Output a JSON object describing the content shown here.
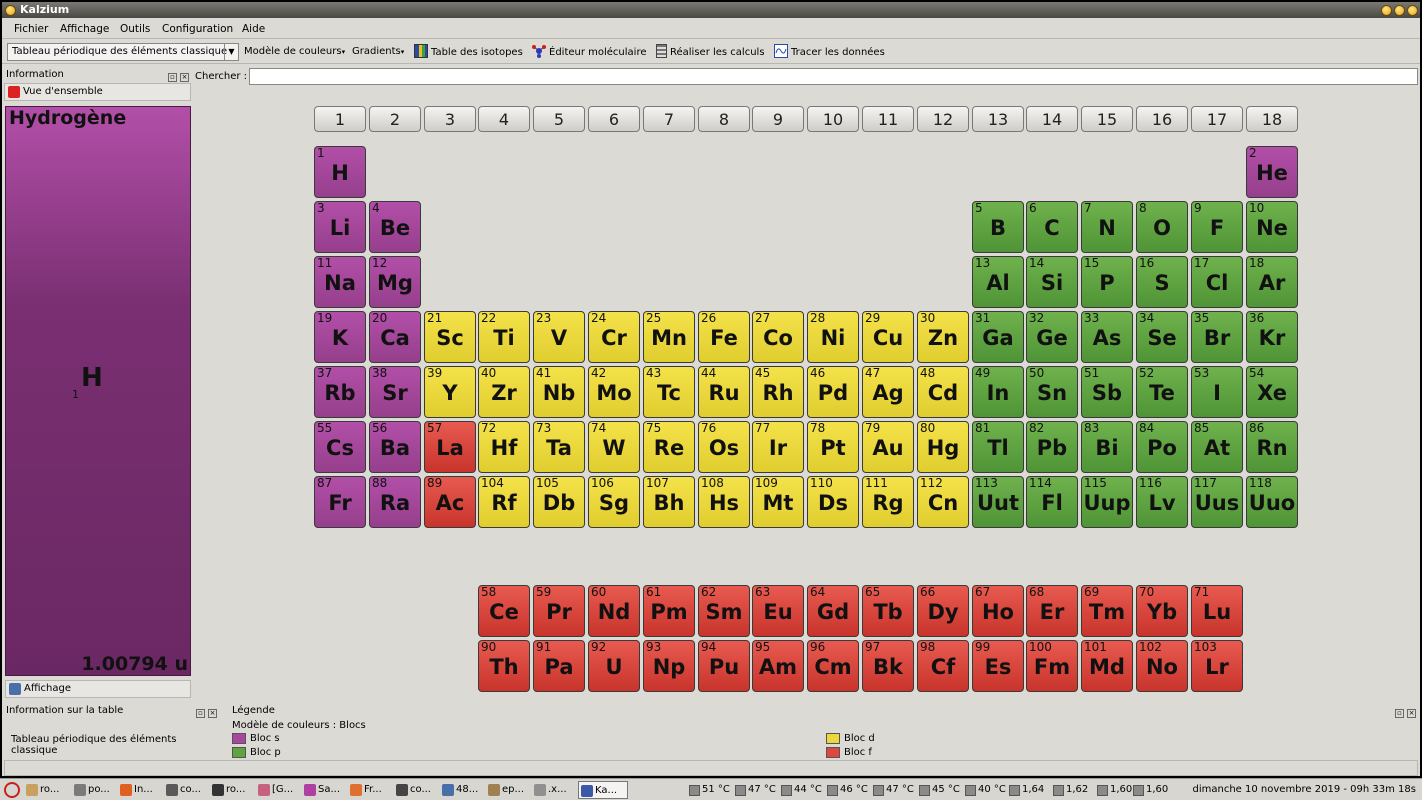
{
  "window": {
    "title": "Kalzium"
  },
  "menu": [
    "Fichier",
    "Affichage",
    "Outils",
    "Configuration",
    "Aide"
  ],
  "toolbar": {
    "table_select": "Tableau périodique des éléments classique",
    "color_model": "Modèle de couleurs",
    "gradients": "Gradients",
    "isotopes": "Table des isotopes",
    "editor": "Éditeur moléculaire",
    "calc": "Réaliser les calculs",
    "plot": "Tracer les données"
  },
  "info_dock": {
    "title": "Information",
    "overview_button": "Vue d'ensemble",
    "display_button": "Affichage",
    "element": {
      "name": "Hydrogène",
      "symbol": "H",
      "number": "1",
      "mass": "1.00794 u"
    }
  },
  "search": {
    "label": "Chercher :",
    "value": ""
  },
  "groups": [
    "1",
    "2",
    "3",
    "4",
    "5",
    "6",
    "7",
    "8",
    "9",
    "10",
    "11",
    "12",
    "13",
    "14",
    "15",
    "16",
    "17",
    "18"
  ],
  "elements": [
    {
      "n": "1",
      "s": "H",
      "b": "s",
      "g": 1,
      "p": 1
    },
    {
      "n": "2",
      "s": "He",
      "b": "s",
      "g": 18,
      "p": 1
    },
    {
      "n": "3",
      "s": "Li",
      "b": "s",
      "g": 1,
      "p": 2
    },
    {
      "n": "4",
      "s": "Be",
      "b": "s",
      "g": 2,
      "p": 2
    },
    {
      "n": "5",
      "s": "B",
      "b": "p",
      "g": 13,
      "p": 2
    },
    {
      "n": "6",
      "s": "C",
      "b": "p",
      "g": 14,
      "p": 2
    },
    {
      "n": "7",
      "s": "N",
      "b": "p",
      "g": 15,
      "p": 2
    },
    {
      "n": "8",
      "s": "O",
      "b": "p",
      "g": 16,
      "p": 2
    },
    {
      "n": "9",
      "s": "F",
      "b": "p",
      "g": 17,
      "p": 2
    },
    {
      "n": "10",
      "s": "Ne",
      "b": "p",
      "g": 18,
      "p": 2
    },
    {
      "n": "11",
      "s": "Na",
      "b": "s",
      "g": 1,
      "p": 3
    },
    {
      "n": "12",
      "s": "Mg",
      "b": "s",
      "g": 2,
      "p": 3
    },
    {
      "n": "13",
      "s": "Al",
      "b": "p",
      "g": 13,
      "p": 3
    },
    {
      "n": "14",
      "s": "Si",
      "b": "p",
      "g": 14,
      "p": 3
    },
    {
      "n": "15",
      "s": "P",
      "b": "p",
      "g": 15,
      "p": 3
    },
    {
      "n": "16",
      "s": "S",
      "b": "p",
      "g": 16,
      "p": 3
    },
    {
      "n": "17",
      "s": "Cl",
      "b": "p",
      "g": 17,
      "p": 3
    },
    {
      "n": "18",
      "s": "Ar",
      "b": "p",
      "g": 18,
      "p": 3
    },
    {
      "n": "19",
      "s": "K",
      "b": "s",
      "g": 1,
      "p": 4
    },
    {
      "n": "20",
      "s": "Ca",
      "b": "s",
      "g": 2,
      "p": 4
    },
    {
      "n": "21",
      "s": "Sc",
      "b": "d",
      "g": 3,
      "p": 4
    },
    {
      "n": "22",
      "s": "Ti",
      "b": "d",
      "g": 4,
      "p": 4
    },
    {
      "n": "23",
      "s": "V",
      "b": "d",
      "g": 5,
      "p": 4
    },
    {
      "n": "24",
      "s": "Cr",
      "b": "d",
      "g": 6,
      "p": 4
    },
    {
      "n": "25",
      "s": "Mn",
      "b": "d",
      "g": 7,
      "p": 4
    },
    {
      "n": "26",
      "s": "Fe",
      "b": "d",
      "g": 8,
      "p": 4
    },
    {
      "n": "27",
      "s": "Co",
      "b": "d",
      "g": 9,
      "p": 4
    },
    {
      "n": "28",
      "s": "Ni",
      "b": "d",
      "g": 10,
      "p": 4
    },
    {
      "n": "29",
      "s": "Cu",
      "b": "d",
      "g": 11,
      "p": 4
    },
    {
      "n": "30",
      "s": "Zn",
      "b": "d",
      "g": 12,
      "p": 4
    },
    {
      "n": "31",
      "s": "Ga",
      "b": "p",
      "g": 13,
      "p": 4
    },
    {
      "n": "32",
      "s": "Ge",
      "b": "p",
      "g": 14,
      "p": 4
    },
    {
      "n": "33",
      "s": "As",
      "b": "p",
      "g": 15,
      "p": 4
    },
    {
      "n": "34",
      "s": "Se",
      "b": "p",
      "g": 16,
      "p": 4
    },
    {
      "n": "35",
      "s": "Br",
      "b": "p",
      "g": 17,
      "p": 4
    },
    {
      "n": "36",
      "s": "Kr",
      "b": "p",
      "g": 18,
      "p": 4
    },
    {
      "n": "37",
      "s": "Rb",
      "b": "s",
      "g": 1,
      "p": 5
    },
    {
      "n": "38",
      "s": "Sr",
      "b": "s",
      "g": 2,
      "p": 5
    },
    {
      "n": "39",
      "s": "Y",
      "b": "d",
      "g": 3,
      "p": 5
    },
    {
      "n": "40",
      "s": "Zr",
      "b": "d",
      "g": 4,
      "p": 5
    },
    {
      "n": "41",
      "s": "Nb",
      "b": "d",
      "g": 5,
      "p": 5
    },
    {
      "n": "42",
      "s": "Mo",
      "b": "d",
      "g": 6,
      "p": 5
    },
    {
      "n": "43",
      "s": "Tc",
      "b": "d",
      "g": 7,
      "p": 5
    },
    {
      "n": "44",
      "s": "Ru",
      "b": "d",
      "g": 8,
      "p": 5
    },
    {
      "n": "45",
      "s": "Rh",
      "b": "d",
      "g": 9,
      "p": 5
    },
    {
      "n": "46",
      "s": "Pd",
      "b": "d",
      "g": 10,
      "p": 5
    },
    {
      "n": "47",
      "s": "Ag",
      "b": "d",
      "g": 11,
      "p": 5
    },
    {
      "n": "48",
      "s": "Cd",
      "b": "d",
      "g": 12,
      "p": 5
    },
    {
      "n": "49",
      "s": "In",
      "b": "p",
      "g": 13,
      "p": 5
    },
    {
      "n": "50",
      "s": "Sn",
      "b": "p",
      "g": 14,
      "p": 5
    },
    {
      "n": "51",
      "s": "Sb",
      "b": "p",
      "g": 15,
      "p": 5
    },
    {
      "n": "52",
      "s": "Te",
      "b": "p",
      "g": 16,
      "p": 5
    },
    {
      "n": "53",
      "s": "I",
      "b": "p",
      "g": 17,
      "p": 5
    },
    {
      "n": "54",
      "s": "Xe",
      "b": "p",
      "g": 18,
      "p": 5
    },
    {
      "n": "55",
      "s": "Cs",
      "b": "s",
      "g": 1,
      "p": 6
    },
    {
      "n": "56",
      "s": "Ba",
      "b": "s",
      "g": 2,
      "p": 6
    },
    {
      "n": "57",
      "s": "La",
      "b": "f",
      "g": 3,
      "p": 6
    },
    {
      "n": "72",
      "s": "Hf",
      "b": "d",
      "g": 4,
      "p": 6
    },
    {
      "n": "73",
      "s": "Ta",
      "b": "d",
      "g": 5,
      "p": 6
    },
    {
      "n": "74",
      "s": "W",
      "b": "d",
      "g": 6,
      "p": 6
    },
    {
      "n": "75",
      "s": "Re",
      "b": "d",
      "g": 7,
      "p": 6
    },
    {
      "n": "76",
      "s": "Os",
      "b": "d",
      "g": 8,
      "p": 6
    },
    {
      "n": "77",
      "s": "Ir",
      "b": "d",
      "g": 9,
      "p": 6
    },
    {
      "n": "78",
      "s": "Pt",
      "b": "d",
      "g": 10,
      "p": 6
    },
    {
      "n": "79",
      "s": "Au",
      "b": "d",
      "g": 11,
      "p": 6
    },
    {
      "n": "80",
      "s": "Hg",
      "b": "d",
      "g": 12,
      "p": 6
    },
    {
      "n": "81",
      "s": "Tl",
      "b": "p",
      "g": 13,
      "p": 6
    },
    {
      "n": "82",
      "s": "Pb",
      "b": "p",
      "g": 14,
      "p": 6
    },
    {
      "n": "83",
      "s": "Bi",
      "b": "p",
      "g": 15,
      "p": 6
    },
    {
      "n": "84",
      "s": "Po",
      "b": "p",
      "g": 16,
      "p": 6
    },
    {
      "n": "85",
      "s": "At",
      "b": "p",
      "g": 17,
      "p": 6
    },
    {
      "n": "86",
      "s": "Rn",
      "b": "p",
      "g": 18,
      "p": 6
    },
    {
      "n": "87",
      "s": "Fr",
      "b": "s",
      "g": 1,
      "p": 7
    },
    {
      "n": "88",
      "s": "Ra",
      "b": "s",
      "g": 2,
      "p": 7
    },
    {
      "n": "89",
      "s": "Ac",
      "b": "f",
      "g": 3,
      "p": 7
    },
    {
      "n": "104",
      "s": "Rf",
      "b": "d",
      "g": 4,
      "p": 7
    },
    {
      "n": "105",
      "s": "Db",
      "b": "d",
      "g": 5,
      "p": 7
    },
    {
      "n": "106",
      "s": "Sg",
      "b": "d",
      "g": 6,
      "p": 7
    },
    {
      "n": "107",
      "s": "Bh",
      "b": "d",
      "g": 7,
      "p": 7
    },
    {
      "n": "108",
      "s": "Hs",
      "b": "d",
      "g": 8,
      "p": 7
    },
    {
      "n": "109",
      "s": "Mt",
      "b": "d",
      "g": 9,
      "p": 7
    },
    {
      "n": "110",
      "s": "Ds",
      "b": "d",
      "g": 10,
      "p": 7
    },
    {
      "n": "111",
      "s": "Rg",
      "b": "d",
      "g": 11,
      "p": 7
    },
    {
      "n": "112",
      "s": "Cn",
      "b": "d",
      "g": 12,
      "p": 7
    },
    {
      "n": "113",
      "s": "Uut",
      "b": "p",
      "g": 13,
      "p": 7
    },
    {
      "n": "114",
      "s": "Fl",
      "b": "p",
      "g": 14,
      "p": 7
    },
    {
      "n": "115",
      "s": "Uup",
      "b": "p",
      "g": 15,
      "p": 7
    },
    {
      "n": "116",
      "s": "Lv",
      "b": "p",
      "g": 16,
      "p": 7
    },
    {
      "n": "117",
      "s": "Uus",
      "b": "p",
      "g": 17,
      "p": 7
    },
    {
      "n": "118",
      "s": "Uuo",
      "b": "p",
      "g": 18,
      "p": 7
    },
    {
      "n": "58",
      "s": "Ce",
      "b": "f",
      "g": 4,
      "p": 9
    },
    {
      "n": "59",
      "s": "Pr",
      "b": "f",
      "g": 5,
      "p": 9
    },
    {
      "n": "60",
      "s": "Nd",
      "b": "f",
      "g": 6,
      "p": 9
    },
    {
      "n": "61",
      "s": "Pm",
      "b": "f",
      "g": 7,
      "p": 9
    },
    {
      "n": "62",
      "s": "Sm",
      "b": "f",
      "g": 8,
      "p": 9
    },
    {
      "n": "63",
      "s": "Eu",
      "b": "f",
      "g": 9,
      "p": 9
    },
    {
      "n": "64",
      "s": "Gd",
      "b": "f",
      "g": 10,
      "p": 9
    },
    {
      "n": "65",
      "s": "Tb",
      "b": "f",
      "g": 11,
      "p": 9
    },
    {
      "n": "66",
      "s": "Dy",
      "b": "f",
      "g": 12,
      "p": 9
    },
    {
      "n": "67",
      "s": "Ho",
      "b": "f",
      "g": 13,
      "p": 9
    },
    {
      "n": "68",
      "s": "Er",
      "b": "f",
      "g": 14,
      "p": 9
    },
    {
      "n": "69",
      "s": "Tm",
      "b": "f",
      "g": 15,
      "p": 9
    },
    {
      "n": "70",
      "s": "Yb",
      "b": "f",
      "g": 16,
      "p": 9
    },
    {
      "n": "71",
      "s": "Lu",
      "b": "f",
      "g": 17,
      "p": 9
    },
    {
      "n": "90",
      "s": "Th",
      "b": "f",
      "g": 4,
      "p": 10
    },
    {
      "n": "91",
      "s": "Pa",
      "b": "f",
      "g": 5,
      "p": 10
    },
    {
      "n": "92",
      "s": "U",
      "b": "f",
      "g": 6,
      "p": 10
    },
    {
      "n": "93",
      "s": "Np",
      "b": "f",
      "g": 7,
      "p": 10
    },
    {
      "n": "94",
      "s": "Pu",
      "b": "f",
      "g": 8,
      "p": 10
    },
    {
      "n": "95",
      "s": "Am",
      "b": "f",
      "g": 9,
      "p": 10
    },
    {
      "n": "96",
      "s": "Cm",
      "b": "f",
      "g": 10,
      "p": 10
    },
    {
      "n": "97",
      "s": "Bk",
      "b": "f",
      "g": 11,
      "p": 10
    },
    {
      "n": "98",
      "s": "Cf",
      "b": "f",
      "g": 12,
      "p": 10
    },
    {
      "n": "99",
      "s": "Es",
      "b": "f",
      "g": 13,
      "p": 10
    },
    {
      "n": "100",
      "s": "Fm",
      "b": "f",
      "g": 14,
      "p": 10
    },
    {
      "n": "101",
      "s": "Md",
      "b": "f",
      "g": 15,
      "p": 10
    },
    {
      "n": "102",
      "s": "No",
      "b": "f",
      "g": 16,
      "p": 10
    },
    {
      "n": "103",
      "s": "Lr",
      "b": "f",
      "g": 17,
      "p": 10
    }
  ],
  "colors": {
    "s": "#a8479e",
    "p": "#5fa440",
    "d": "#ecd83c",
    "f": "#dc4840"
  },
  "bottom": {
    "info_title": "Information sur la table",
    "info_text": "Tableau périodique des éléments classique",
    "legend_title": "Légende",
    "legend_model": "Modèle de couleurs : Blocs",
    "legend": {
      "s": "Bloc s",
      "p": "Bloc p",
      "d": "Bloc d",
      "f": "Bloc f"
    }
  },
  "taskbar": {
    "tasks": [
      "ro...",
      "po...",
      "In...",
      "co...",
      "ro...",
      "[G...",
      "Sa...",
      "Fr...",
      "co...",
      "48...",
      "ep...",
      ".x...",
      "Ka..."
    ],
    "tray": [
      "51 °C",
      "47 °C",
      "44 °C",
      "46 °C",
      "47 °C",
      "45 °C",
      "40 °C",
      "1,64",
      "1,62",
      "1,60",
      "1,60"
    ],
    "clock": "dimanche 10 novembre 2019 - 09h 33m 18s"
  }
}
